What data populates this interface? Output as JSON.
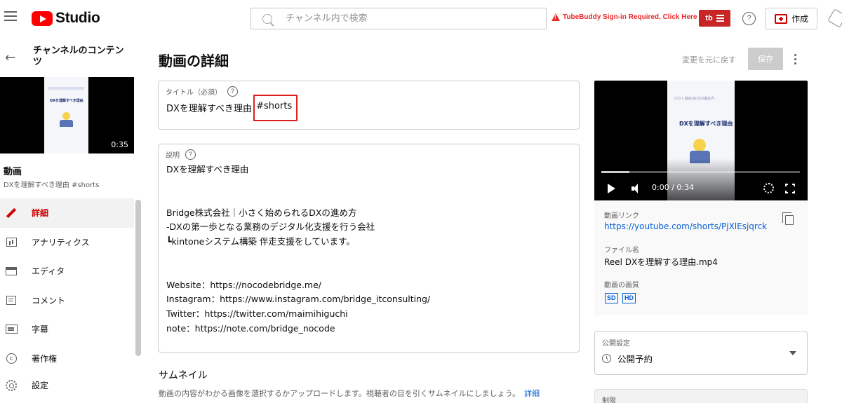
{
  "header": {
    "logo_text": "Studio",
    "search_placeholder": "チャンネル内で検索",
    "tubebuddy_warning": "TubeBuddy Sign-in Required, Click Here",
    "tubebuddy_button": "tb",
    "help_symbol": "?",
    "create_label": "作成"
  },
  "sidebar": {
    "channel_title": "チャンネルのコンテンツ",
    "thumbnail_duration": "0:35",
    "video_label": "動画",
    "video_title": "DXを理解すべき理由 #shorts",
    "items": [
      {
        "label": "詳細",
        "icon": "pencil-icon",
        "active": true
      },
      {
        "label": "アナリティクス",
        "icon": "analytics-icon"
      },
      {
        "label": "エディタ",
        "icon": "editor-icon"
      },
      {
        "label": "コメント",
        "icon": "comment-icon"
      },
      {
        "label": "字幕",
        "icon": "subtitles-icon"
      },
      {
        "label": "著作権",
        "icon": "copyright-icon"
      }
    ],
    "settings_label": "設定"
  },
  "main": {
    "page_title": "動画の詳細",
    "undo_label": "変更を元に戻す",
    "save_label": "保存",
    "title_field": {
      "label": "タイトル（必須）",
      "value_main": "DXを理解すべき理由 ",
      "value_highlight": "#shorts"
    },
    "description_field": {
      "label": "説明",
      "lines": [
        "DXを理解すべき理由",
        "",
        "",
        "Bridge株式会社｜小さく始められるDXの進め方",
        "-DXの第一歩となる業務のデジタル化支援を行う会社",
        "┗kintoneシステム構築 伴走支援をしています。",
        "",
        "",
        "Website：https://nocodebridge.me/",
        "Instagram：https://www.instagram.com/bridge_itconsulting/",
        "Twitter：https://twitter.com/maimihiguchi",
        "note：https://note.com/bridge_nocode"
      ]
    },
    "thumbnail_section": {
      "heading": "サムネイル",
      "help_text": "動画の内容がわかる画像を選択するかアップロードします。視聴者の目を引くサムネイルにしましょう。",
      "help_link": "詳細"
    }
  },
  "preview": {
    "frame_top_text": "小さく始めるDXの進め方",
    "frame_title": "DXを理解すべき理由",
    "time_display": "0:00 / 0:34",
    "progress_fraction": 0.14,
    "link_label": "動画リンク",
    "link_url": "https://youtube.com/shorts/PjXlEsjqrck",
    "filename_label": "ファイル名",
    "filename": "Reel DXを理解する理由.mp4",
    "quality_label": "動画の画質",
    "quality_badges": [
      "SD",
      "HD"
    ]
  },
  "visibility": {
    "label": "公開設定",
    "value": "公開予約"
  },
  "restrictions": {
    "label": "制限"
  },
  "colors": {
    "accent_red": "#cc0000",
    "link_blue": "#065fd4",
    "tubebuddy_red": "#c82626"
  }
}
